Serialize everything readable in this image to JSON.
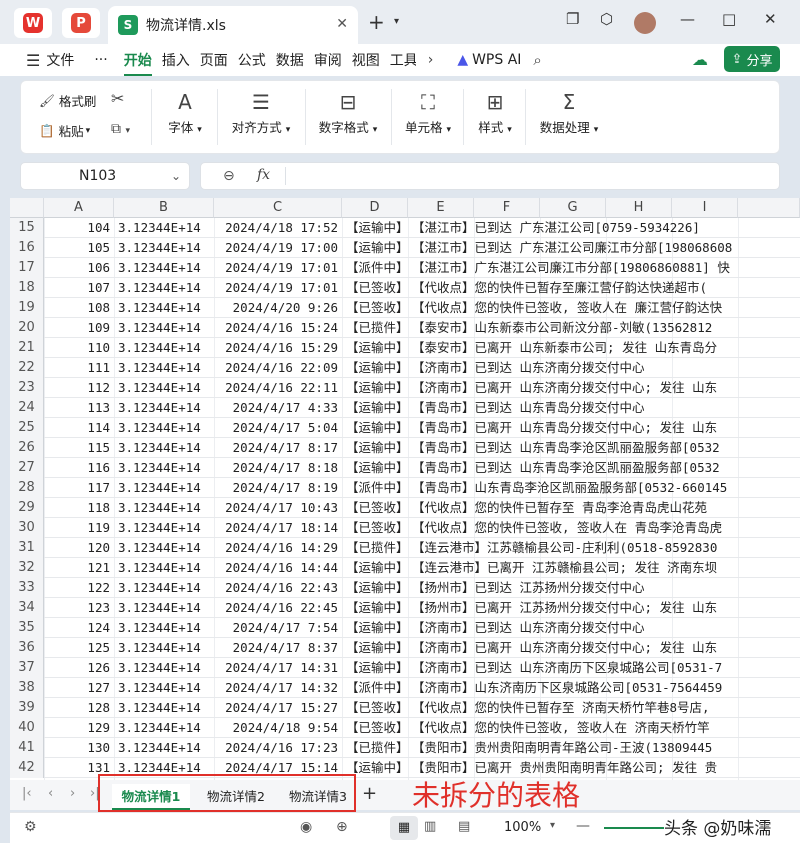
{
  "window": {
    "tab_title": "物流详情.xls",
    "new_tab": "+",
    "minimize": "—",
    "maximize": "□",
    "close": "✕"
  },
  "menubar": {
    "file": "文件",
    "more": "···",
    "items": [
      "开始",
      "插入",
      "页面",
      "公式",
      "数据",
      "审阅",
      "视图",
      "工具"
    ],
    "wps_ai": "WPS AI",
    "share": "分享"
  },
  "ribbon": {
    "format_painter": "格式刷",
    "paste": "粘贴",
    "font": "字体",
    "align": "对齐方式",
    "number_format": "数字格式",
    "cell": "单元格",
    "style": "样式",
    "data_process": "数据处理"
  },
  "formula": {
    "name_box": "N103",
    "fx_label": "fx",
    "value": ""
  },
  "columns": [
    "A",
    "B",
    "C",
    "D",
    "E",
    "F",
    "G",
    "H",
    "I"
  ],
  "rows": [
    {
      "n": "15",
      "a": "104",
      "b": "3.12344E+14",
      "c": "2024/4/18 17:52",
      "d": "【运输中】",
      "e": "【湛江市】已到达 广东湛江公司[0759-5934226]"
    },
    {
      "n": "16",
      "a": "105",
      "b": "3.12344E+14",
      "c": "2024/4/19 17:00",
      "d": "【运输中】",
      "e": "【湛江市】已到达 广东湛江公司廉江市分部[198068608"
    },
    {
      "n": "17",
      "a": "106",
      "b": "3.12344E+14",
      "c": "2024/4/19 17:01",
      "d": "【派件中】",
      "e": "【湛江市】广东湛江公司廉江市分部[19806860881] 快"
    },
    {
      "n": "18",
      "a": "107",
      "b": "3.12344E+14",
      "c": "2024/4/19 17:01",
      "d": "【已签收】",
      "e": "【代收点】您的快件已暂存至廉江营仔韵达快递超市("
    },
    {
      "n": "19",
      "a": "108",
      "b": "3.12344E+14",
      "c": "2024/4/20 9:26",
      "d": "【已签收】",
      "e": "【代收点】您的快件已签收, 签收人在 廉江营仔韵达快"
    },
    {
      "n": "20",
      "a": "109",
      "b": "3.12344E+14",
      "c": "2024/4/16 15:24",
      "d": "【已揽件】",
      "e": "【泰安市】山东新泰市公司新汶分部-刘敏(13562812"
    },
    {
      "n": "21",
      "a": "110",
      "b": "3.12344E+14",
      "c": "2024/4/16 15:29",
      "d": "【运输中】",
      "e": "【泰安市】已离开 山东新泰市公司; 发往 山东青岛分"
    },
    {
      "n": "22",
      "a": "111",
      "b": "3.12344E+14",
      "c": "2024/4/16 22:09",
      "d": "【运输中】",
      "e": "【济南市】已到达 山东济南分拨交付中心"
    },
    {
      "n": "23",
      "a": "112",
      "b": "3.12344E+14",
      "c": "2024/4/16 22:11",
      "d": "【运输中】",
      "e": "【济南市】已离开 山东济南分拨交付中心; 发往 山东"
    },
    {
      "n": "24",
      "a": "113",
      "b": "3.12344E+14",
      "c": "2024/4/17 4:33",
      "d": "【运输中】",
      "e": "【青岛市】已到达 山东青岛分拨交付中心"
    },
    {
      "n": "25",
      "a": "114",
      "b": "3.12344E+14",
      "c": "2024/4/17 5:04",
      "d": "【运输中】",
      "e": "【青岛市】已离开 山东青岛分拨交付中心; 发往 山东"
    },
    {
      "n": "26",
      "a": "115",
      "b": "3.12344E+14",
      "c": "2024/4/17 8:17",
      "d": "【运输中】",
      "e": "【青岛市】已到达 山东青岛李沧区凯丽盈服务部[0532"
    },
    {
      "n": "27",
      "a": "116",
      "b": "3.12344E+14",
      "c": "2024/4/17 8:18",
      "d": "【运输中】",
      "e": "【青岛市】已到达 山东青岛李沧区凯丽盈服务部[0532"
    },
    {
      "n": "28",
      "a": "117",
      "b": "3.12344E+14",
      "c": "2024/4/17 8:19",
      "d": "【派件中】",
      "e": "【青岛市】山东青岛李沧区凯丽盈服务部[0532-660145"
    },
    {
      "n": "29",
      "a": "118",
      "b": "3.12344E+14",
      "c": "2024/4/17 10:43",
      "d": "【已签收】",
      "e": "【代收点】您的快件已暂存至 青岛李沧青岛虎山花苑"
    },
    {
      "n": "30",
      "a": "119",
      "b": "3.12344E+14",
      "c": "2024/4/17 18:14",
      "d": "【已签收】",
      "e": "【代收点】您的快件已签收, 签收人在 青岛李沧青岛虎"
    },
    {
      "n": "31",
      "a": "120",
      "b": "3.12344E+14",
      "c": "2024/4/16 14:29",
      "d": "【已揽件】",
      "e": "【连云港市】江苏赣榆县公司-庄利利(0518-8592830"
    },
    {
      "n": "32",
      "a": "121",
      "b": "3.12344E+14",
      "c": "2024/4/16 14:44",
      "d": "【运输中】",
      "e": "【连云港市】已离开 江苏赣榆县公司; 发往 济南东坝"
    },
    {
      "n": "33",
      "a": "122",
      "b": "3.12344E+14",
      "c": "2024/4/16 22:43",
      "d": "【运输中】",
      "e": "【扬州市】已到达 江苏扬州分拨交付中心"
    },
    {
      "n": "34",
      "a": "123",
      "b": "3.12344E+14",
      "c": "2024/4/16 22:45",
      "d": "【运输中】",
      "e": "【扬州市】已离开 江苏扬州分拨交付中心; 发往 山东"
    },
    {
      "n": "35",
      "a": "124",
      "b": "3.12344E+14",
      "c": "2024/4/17 7:54",
      "d": "【运输中】",
      "e": "【济南市】已到达 山东济南分拨交付中心"
    },
    {
      "n": "36",
      "a": "125",
      "b": "3.12344E+14",
      "c": "2024/4/17 8:37",
      "d": "【运输中】",
      "e": "【济南市】已离开 山东济南分拨交付中心; 发往 山东"
    },
    {
      "n": "37",
      "a": "126",
      "b": "3.12344E+14",
      "c": "2024/4/17 14:31",
      "d": "【运输中】",
      "e": "【济南市】已到达 山东济南历下区泉城路公司[0531-7"
    },
    {
      "n": "38",
      "a": "127",
      "b": "3.12344E+14",
      "c": "2024/4/17 14:32",
      "d": "【派件中】",
      "e": "【济南市】山东济南历下区泉城路公司[0531-7564459"
    },
    {
      "n": "39",
      "a": "128",
      "b": "3.12344E+14",
      "c": "2024/4/17 15:27",
      "d": "【已签收】",
      "e": "【代收点】您的快件已暂存至 济南天桥竹竿巷8号店,"
    },
    {
      "n": "40",
      "a": "129",
      "b": "3.12344E+14",
      "c": "2024/4/18 9:54",
      "d": "【已签收】",
      "e": "【代收点】您的快件已签收, 签收人在 济南天桥竹竿"
    },
    {
      "n": "41",
      "a": "130",
      "b": "3.12344E+14",
      "c": "2024/4/16 17:23",
      "d": "【已揽件】",
      "e": "【贵阳市】贵州贵阳南明青年路公司-王波(13809445"
    },
    {
      "n": "42",
      "a": "131",
      "b": "3.12344E+14",
      "c": "2024/4/17 15:14",
      "d": "【运输中】",
      "e": "【贵阳市】已离开 贵州贵阳南明青年路公司; 发往 贵"
    }
  ],
  "sheets": [
    "物流详情1",
    "物流详情2",
    "物流详情3"
  ],
  "annotation": "未拆分的表格",
  "status": {
    "zoom": "100%",
    "watermark": "头条 @奶味濡"
  },
  "colors": {
    "brand_green": "#1a8a4e",
    "annotation_red": "#e0302a"
  }
}
